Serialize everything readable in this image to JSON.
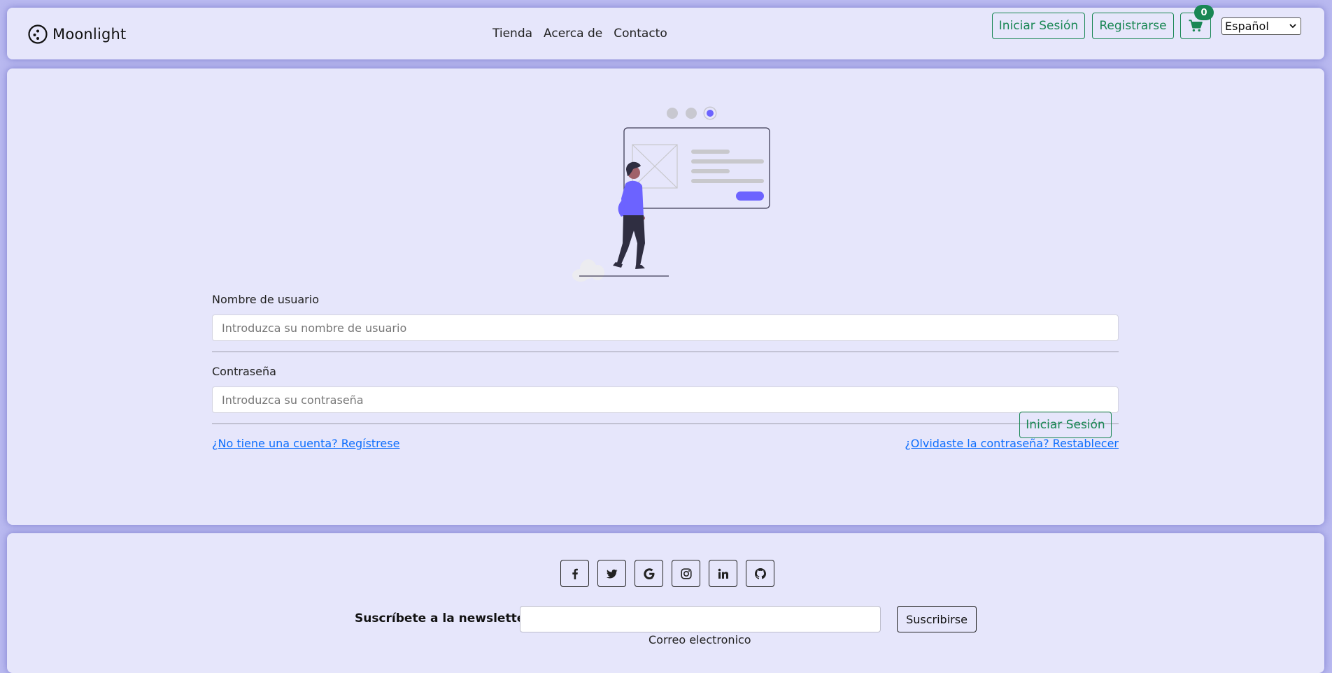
{
  "brand": {
    "name": "Moonlight",
    "logo_icon": "moon-logo-icon"
  },
  "nav": {
    "links": [
      "Tienda",
      "Acerca de",
      "Contacto"
    ]
  },
  "header": {
    "login_label": "Iniciar Sesión",
    "register_label": "Registrarse",
    "cart_icon": "cart-icon",
    "cart_count": "0",
    "language": "Español"
  },
  "carousel": {
    "slide_count": 3,
    "active_index": 2
  },
  "form": {
    "username_label": "Nombre de usuario",
    "username_placeholder": "Introduzca su nombre de usuario",
    "password_label": "Contraseña",
    "password_placeholder": "Introduzca su contraseña",
    "register_link": "¿No tiene una cuenta? Regístrese",
    "forgot_link": "¿Olvidaste la contraseña? Restablecer",
    "submit_label": "Iniciar Sesión"
  },
  "footer": {
    "socials": [
      "facebook-icon",
      "twitter-icon",
      "google-icon",
      "instagram-icon",
      "linkedin-icon",
      "github-icon"
    ],
    "newsletter_label": "Suscríbete a la newsletter",
    "subscribe_label": "Suscribirse",
    "email_caption": "Correo electronico",
    "email_value": ""
  },
  "colors": {
    "page_bg": "#b9b9f0",
    "card_bg": "#e6e6fb",
    "accent_green": "#198754",
    "link_blue": "#0d6efd",
    "illustration_purple": "#6c63ff"
  }
}
